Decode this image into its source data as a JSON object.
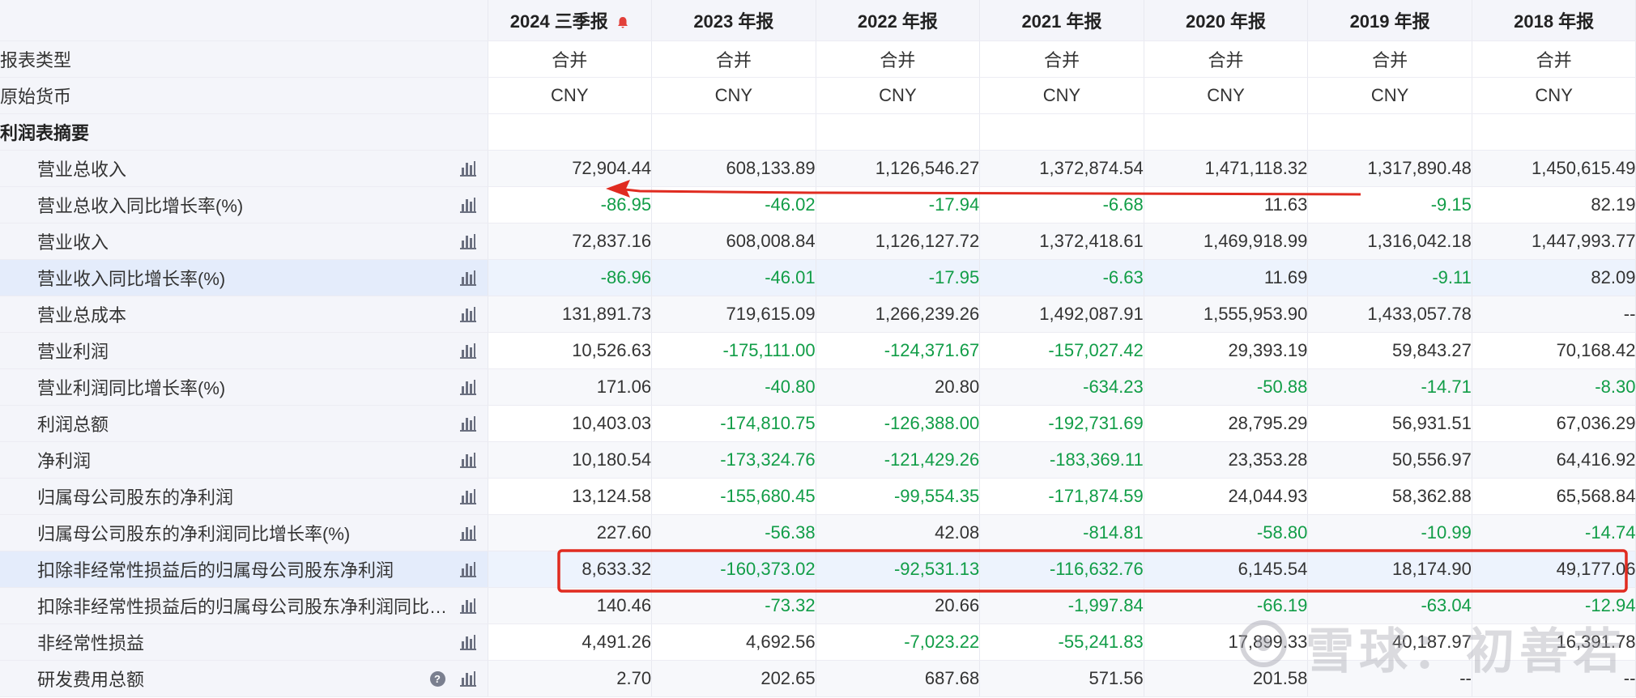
{
  "columns": [
    "2024 三季报",
    "2023 年报",
    "2022 年报",
    "2021 年报",
    "2020 年报",
    "2019 年报",
    "2018 年报"
  ],
  "rows": [
    {
      "label": "报表类型",
      "kind": "meta",
      "values": [
        "合并",
        "合并",
        "合并",
        "合并",
        "合并",
        "合并",
        "合并"
      ]
    },
    {
      "label": "原始货币",
      "kind": "meta",
      "values": [
        "CNY",
        "CNY",
        "CNY",
        "CNY",
        "CNY",
        "CNY",
        "CNY"
      ]
    },
    {
      "label": "利润表摘要",
      "kind": "section",
      "values": [
        "",
        "",
        "",
        "",
        "",
        "",
        ""
      ]
    },
    {
      "label": "营业总收入",
      "kind": "data",
      "values": [
        "72,904.44",
        "608,133.89",
        "1,126,546.27",
        "1,372,874.54",
        "1,471,118.32",
        "1,317,890.48",
        "1,450,615.49"
      ]
    },
    {
      "label": "营业总收入同比增长率(%)",
      "kind": "data",
      "values": [
        "-86.95",
        "-46.02",
        "-17.94",
        "-6.68",
        "11.63",
        "-9.15",
        "82.19"
      ]
    },
    {
      "label": "营业收入",
      "kind": "data",
      "values": [
        "72,837.16",
        "608,008.84",
        "1,126,127.72",
        "1,372,418.61",
        "1,469,918.99",
        "1,316,042.18",
        "1,447,993.77"
      ]
    },
    {
      "label": "营业收入同比增长率(%)",
      "kind": "data",
      "values": [
        "-86.96",
        "-46.01",
        "-17.95",
        "-6.63",
        "11.69",
        "-9.11",
        "82.09"
      ]
    },
    {
      "label": "营业总成本",
      "kind": "data",
      "values": [
        "131,891.73",
        "719,615.09",
        "1,266,239.26",
        "1,492,087.91",
        "1,555,953.90",
        "1,433,057.78",
        "--"
      ]
    },
    {
      "label": "营业利润",
      "kind": "data",
      "values": [
        "10,526.63",
        "-175,111.00",
        "-124,371.67",
        "-157,027.42",
        "29,393.19",
        "59,843.27",
        "70,168.42"
      ]
    },
    {
      "label": "营业利润同比增长率(%)",
      "kind": "data",
      "values": [
        "171.06",
        "-40.80",
        "20.80",
        "-634.23",
        "-50.88",
        "-14.71",
        "-8.30"
      ]
    },
    {
      "label": "利润总额",
      "kind": "data",
      "values": [
        "10,403.03",
        "-174,810.75",
        "-126,388.00",
        "-192,731.69",
        "28,795.29",
        "56,931.51",
        "67,036.29"
      ]
    },
    {
      "label": "净利润",
      "kind": "data",
      "values": [
        "10,180.54",
        "-173,324.76",
        "-121,429.26",
        "-183,369.11",
        "23,353.28",
        "50,556.97",
        "64,416.92"
      ]
    },
    {
      "label": "归属母公司股东的净利润",
      "kind": "data",
      "values": [
        "13,124.58",
        "-155,680.45",
        "-99,554.35",
        "-171,874.59",
        "24,044.93",
        "58,362.88",
        "65,568.84"
      ]
    },
    {
      "label": "归属母公司股东的净利润同比增长率(%)",
      "kind": "data",
      "values": [
        "227.60",
        "-56.38",
        "42.08",
        "-814.81",
        "-58.80",
        "-10.99",
        "-14.74"
      ]
    },
    {
      "label": "扣除非经常性损益后的归属母公司股东净利润",
      "kind": "data",
      "values": [
        "8,633.32",
        "-160,373.02",
        "-92,531.13",
        "-116,632.76",
        "6,145.54",
        "18,174.90",
        "49,177.06"
      ]
    },
    {
      "label": "扣除非经常性损益后的归属母公司股东净利润同比增...",
      "kind": "data",
      "values": [
        "140.46",
        "-73.32",
        "20.66",
        "-1,997.84",
        "-66.19",
        "-63.04",
        "-12.94"
      ]
    },
    {
      "label": "非经常性损益",
      "kind": "data",
      "values": [
        "4,491.26",
        "4,692.56",
        "-7,023.22",
        "-55,241.83",
        "17,899.33",
        "40,187.97",
        "16,391.78"
      ]
    },
    {
      "label": "研发费用总额",
      "kind": "data",
      "has_help": true,
      "values": [
        "2.70",
        "202.65",
        "687.68",
        "571.56",
        "201.58",
        "--",
        "--"
      ]
    }
  ],
  "icons": {
    "bar": "bar-chart-icon",
    "help": "help-icon",
    "bell": "bell-icon"
  },
  "help_glyph": "?",
  "colors": {
    "negative": "#119d47",
    "annotation": "#e02b20",
    "header_bg": "#f4f5fa",
    "highlight_bg": "#edf3fd"
  },
  "annotations": {
    "arrow": "red arrow pointing left along row 营业总收入同比增长率(%)",
    "box": "red rectangle around values of row 扣除非经常性损益后的归属母公司股东净利润"
  },
  "watermark": {
    "text": "雪球：初善若"
  }
}
